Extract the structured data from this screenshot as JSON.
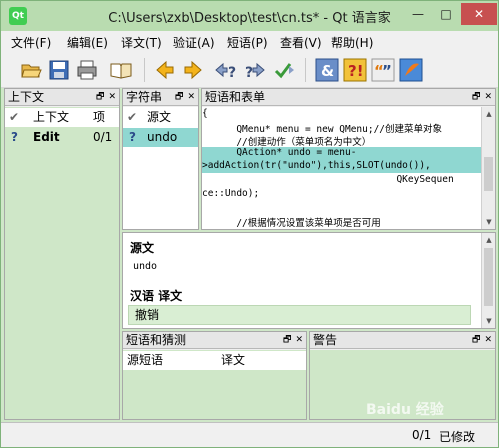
{
  "window": {
    "title": "C:\\Users\\zxb\\Desktop\\test\\cn.ts* - Qt 语言家",
    "icon_text": "Qt"
  },
  "window_controls": {
    "minimize": "—",
    "maximize": "□",
    "close": "✕"
  },
  "menubar": [
    "文件(F)",
    "编辑(E)",
    "译文(T)",
    "验证(A)",
    "短语(P)",
    "查看(V)",
    "帮助(H)"
  ],
  "toolbar": {
    "items": [
      "open-icon",
      "save-icon",
      "print-icon",
      "phrase-book-icon",
      "prev-icon",
      "next-icon",
      "prev-unfinished-icon",
      "next-unfinished-icon",
      "done-and-next-icon",
      "accelerator-icon",
      "ending-punctuation-icon",
      "phrase-match-icon",
      "place-marker-icon"
    ]
  },
  "dock_buttons": {
    "float": "🗗",
    "close": "✕"
  },
  "context": {
    "title": "上下文",
    "header": {
      "name": "上下文",
      "items": "项"
    },
    "rows": [
      {
        "name": "Edit",
        "items": "0/1",
        "status_icon": "question-icon"
      }
    ]
  },
  "strings": {
    "title": "字符串",
    "header": "源文",
    "rows": [
      {
        "text": "undo",
        "status_icon": "question-icon"
      }
    ]
  },
  "sources": {
    "title": "短语和表单",
    "lines": [
      "{",
      "      QMenu* menu = new QMenu;//创建菜单对象",
      "      //创建动作（菜单项名为中文）",
      "      QAction* undo = menu-",
      ">addAction(tr(\"undo\"),this,SLOT(undo()),",
      "                                  QKeySequen",
      "ce::Undo);",
      "",
      "      //根据情况设置该菜单项是否可用"
    ]
  },
  "editor": {
    "source_label": "源文",
    "source_text": "undo",
    "translation_label": "汉语 译文",
    "translation_text": "撤销"
  },
  "phrases": {
    "title": "短语和猜测",
    "headers": [
      "源短语",
      "译文"
    ]
  },
  "warnings": {
    "title": "警告"
  },
  "statusbar": {
    "count": "0/1",
    "state": "已修改"
  },
  "watermark": "Baidu 经验"
}
